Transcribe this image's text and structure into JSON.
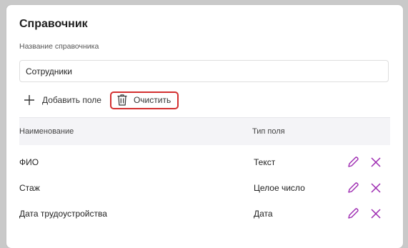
{
  "card": {
    "title": "Справочник",
    "name_label": "Название справочника",
    "name_value": "Сотрудники"
  },
  "toolbar": {
    "add_label": "Добавить поле",
    "clear_label": "Очистить"
  },
  "table": {
    "headers": {
      "name": "Наименование",
      "type": "Тип поля"
    },
    "rows": [
      {
        "name": "ФИО",
        "type": "Текст"
      },
      {
        "name": "Стаж",
        "type": "Целое число"
      },
      {
        "name": "Дата трудоустройства",
        "type": "Дата"
      }
    ]
  },
  "icons": {
    "add": "plus-icon",
    "clear": "trash-icon",
    "edit": "pencil-icon",
    "delete": "close-icon"
  },
  "colors": {
    "accent": "#9c27b0",
    "highlight_border": "#d32f2f",
    "header_bg": "#f4f4f7"
  }
}
